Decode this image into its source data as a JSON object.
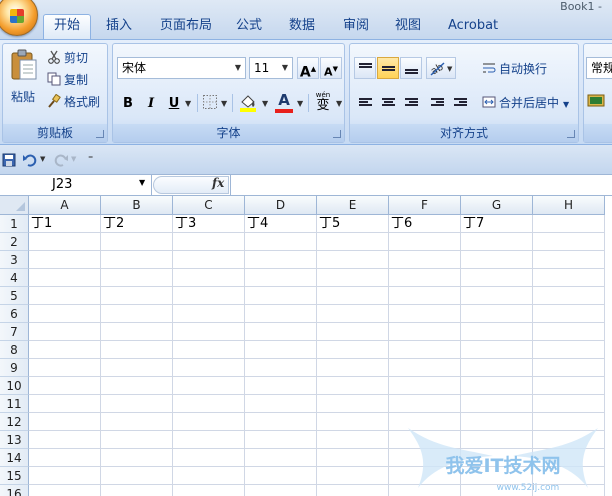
{
  "window": {
    "title": "Book1 -"
  },
  "tabs": [
    "开始",
    "插入",
    "页面布局",
    "公式",
    "数据",
    "审阅",
    "视图",
    "Acrobat"
  ],
  "ribbon": {
    "clipboard": {
      "label": "剪贴板",
      "paste": "粘贴",
      "cut": "剪切",
      "copy": "复制",
      "format_painter": "格式刷"
    },
    "font": {
      "label": "字体",
      "name": "宋体",
      "size": "11",
      "bold": "B",
      "italic": "I",
      "underline": "U",
      "font_color_letter": "A",
      "phonetic": "wén",
      "phonetic_char": "变",
      "grow": "A",
      "shrink": "A"
    },
    "alignment": {
      "label": "对齐方式",
      "wrap_text": "自动换行",
      "merge_center": "合并后居中"
    },
    "number": {
      "format": "常规"
    }
  },
  "colors": {
    "accent": "#15428b",
    "highlight": "#ffd257",
    "font_color": "#e8201c",
    "fill_color": "#ffff00"
  },
  "formula_bar": {
    "name_box": "J23",
    "fx": "fx",
    "value": ""
  },
  "sheet": {
    "columns": [
      "A",
      "B",
      "C",
      "D",
      "E",
      "F",
      "G",
      "H"
    ],
    "rows": [
      "1",
      "2",
      "3",
      "4",
      "5",
      "6",
      "7",
      "8",
      "9",
      "10",
      "11",
      "12",
      "13",
      "14",
      "15",
      "16"
    ],
    "row1": [
      "丁1",
      "丁2",
      "丁3",
      "丁4",
      "丁5",
      "丁6",
      "丁7",
      ""
    ]
  },
  "watermark": {
    "text": "我爱IT技术网",
    "url": "www.52ij.com"
  }
}
